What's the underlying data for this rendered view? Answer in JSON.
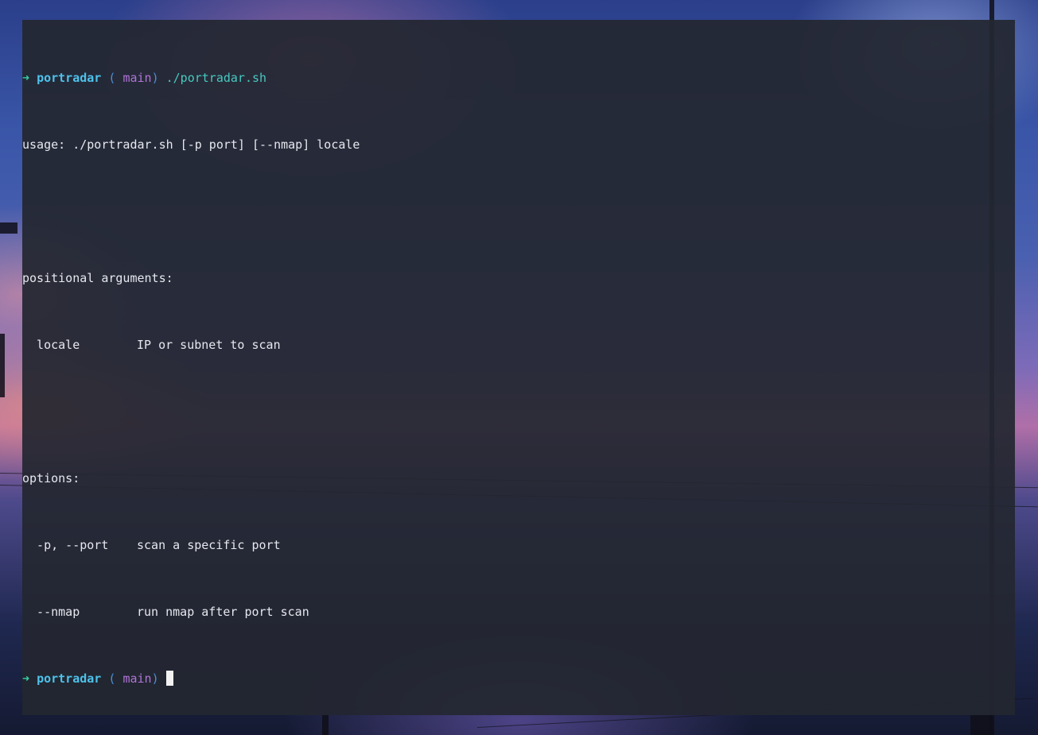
{
  "terminal": {
    "prompt_arrow": "➜",
    "prompt_dir": "portradar",
    "git_open": "(",
    "git_icon": "",
    "git_branch": "main",
    "git_close": ")",
    "command": "./portradar.sh",
    "output": {
      "usage": "usage: ./portradar.sh [-p port] [--nmap] locale",
      "positional_header": "positional arguments:",
      "positional_args": [
        {
          "name": "  locale",
          "desc": "IP or subnet to scan"
        }
      ],
      "options_header": "options:",
      "options": [
        {
          "name": "  -p, --port",
          "desc": "scan a specific port"
        },
        {
          "name": "  --nmap",
          "desc": "run nmap after port scan"
        }
      ]
    }
  },
  "colors": {
    "terminal_bg": "#242730",
    "text": "#e6e8ee",
    "arrow": "#35d0a0",
    "dir": "#4ec2ea",
    "paren": "#4a8fd6",
    "git_icon": "#e8a44a",
    "branch": "#b074d8",
    "command": "#46c9c0"
  }
}
